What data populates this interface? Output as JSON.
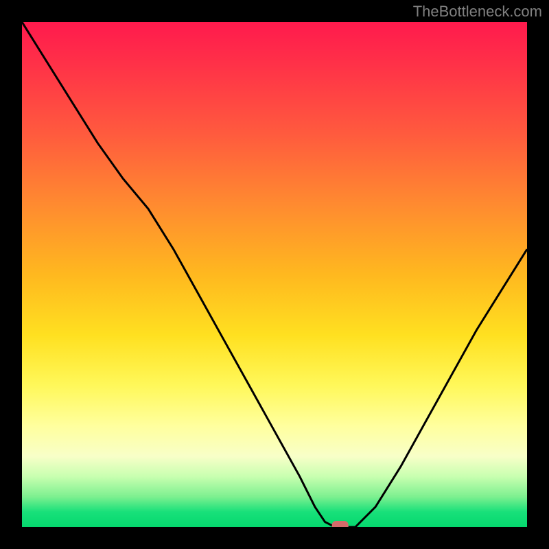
{
  "watermark": "TheBottleneck.com",
  "chart_data": {
    "type": "line",
    "title": "",
    "xlabel": "",
    "ylabel": "",
    "xlim": [
      0,
      100
    ],
    "ylim": [
      0,
      100
    ],
    "x": [
      0,
      5,
      10,
      15,
      20,
      25,
      30,
      35,
      40,
      45,
      50,
      55,
      58,
      60,
      62,
      64,
      66,
      70,
      75,
      80,
      85,
      90,
      95,
      100
    ],
    "values": [
      100,
      92,
      84,
      76,
      69,
      63,
      55,
      46,
      37,
      28,
      19,
      10,
      4,
      1,
      0,
      0,
      0,
      4,
      12,
      21,
      30,
      39,
      47,
      55
    ],
    "minimum_marker": {
      "x": 63,
      "y": 0
    },
    "gradient_background": {
      "direction": "top-to-bottom",
      "stops": [
        {
          "pos": 0.0,
          "color": "#ff1a4d"
        },
        {
          "pos": 0.5,
          "color": "#ffb81f"
        },
        {
          "pos": 0.8,
          "color": "#ffff9e"
        },
        {
          "pos": 1.0,
          "color": "#05d86e"
        }
      ]
    }
  }
}
